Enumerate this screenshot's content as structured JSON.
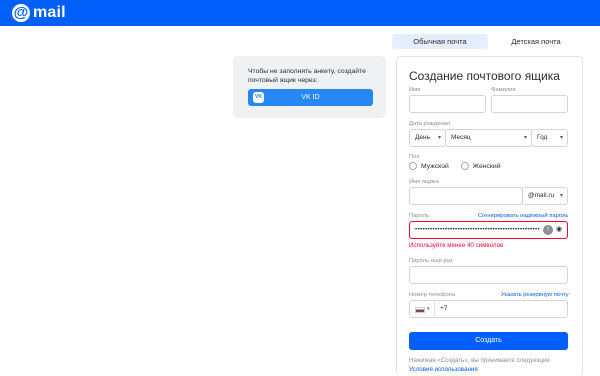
{
  "header": {
    "logo_symbol": "@",
    "logo_text": "mail",
    "background": "#005ff9"
  },
  "tabs": [
    {
      "label": "Обычная почта",
      "active": true
    },
    {
      "label": "Детская почта",
      "active": false
    }
  ],
  "vk_card": {
    "text": "Чтобы не заполнять анкету, создайте почтовый ящик через:",
    "button_label": "VK ID",
    "logo_text": "VK"
  },
  "form": {
    "title": "Создание почтового ящика",
    "first_name": {
      "label": "Имя",
      "value": ""
    },
    "last_name": {
      "label": "Фамилия",
      "value": ""
    },
    "birthdate": {
      "label": "Дата рождения",
      "day": "День",
      "month": "Месяц",
      "year": "Год"
    },
    "gender": {
      "label": "Пол",
      "options": [
        "Мужской",
        "Женский"
      ]
    },
    "mailbox": {
      "label": "Имя ящика",
      "value": "",
      "domain": "@mail.ru"
    },
    "password": {
      "label": "Пароль",
      "generate_link": "Сгенерировать надёжный пароль",
      "value": "••••••••••••••••••••••••••••••••••••••••••••••••••",
      "error": "Используйте менее 40 символов"
    },
    "password_repeat": {
      "label": "Пароль ещё раз",
      "value": ""
    },
    "phone": {
      "label": "Номер телефона",
      "alt_link": "Указать резервную почту",
      "prefix": "+7"
    },
    "submit_label": "Создать",
    "terms_text": "Нажимая «Создать», вы принимаете следующие",
    "terms_link": "Условия использования"
  },
  "colors": {
    "accent": "#005ff9",
    "error": "#ed0a34",
    "vk": "#2787f5"
  }
}
